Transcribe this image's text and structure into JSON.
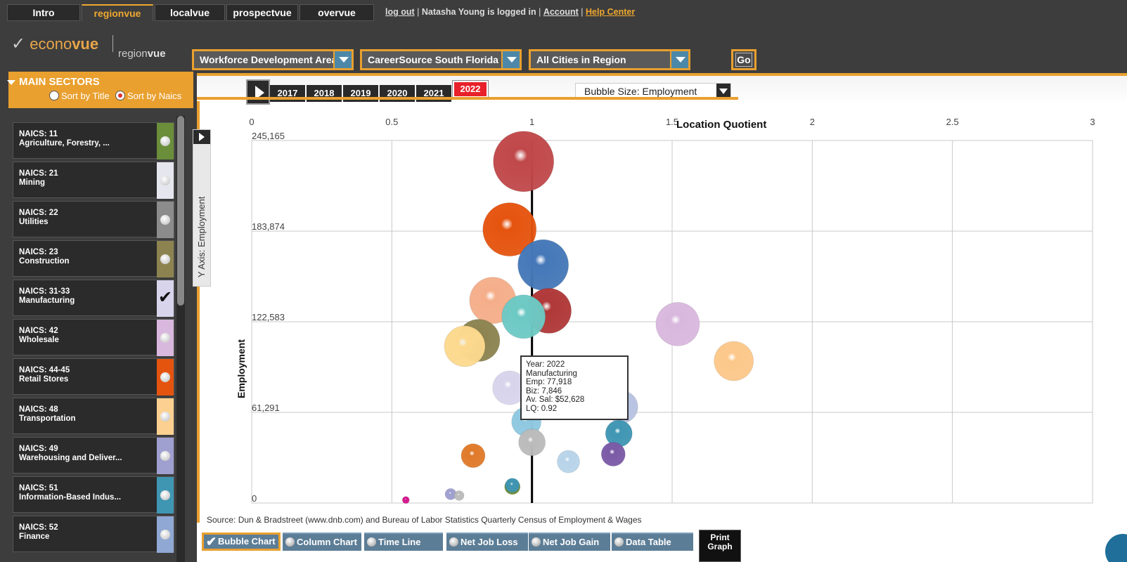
{
  "nav": {
    "tabs": [
      "Intro",
      "regionvue",
      "localvue",
      "prospectvue",
      "overvue"
    ],
    "active_index": 1,
    "log_out": "log out",
    "separator1": " | ",
    "user_text": "Natasha Young is logged in",
    "separator2": " | ",
    "account": "Account",
    "separator3": " | ",
    "help_center": "Help Center"
  },
  "logo": {
    "brand_light": "econo",
    "brand_bold": "vue",
    "sub_light": "region",
    "sub_bold": "vue"
  },
  "filters": {
    "area_type": "Workforce Development Areas",
    "region": "CareerSource South Florida",
    "cities": "All Cities in Region",
    "go_label": "Go"
  },
  "sidebar": {
    "title": "MAIN SECTORS",
    "sort_title": "Sort by Title",
    "sort_naics": "Sort by Naics",
    "sort_selected": "naics",
    "sectors": [
      {
        "code": "NAICS: 11",
        "name": "Agriculture, Forestry, ...",
        "color": "#6b8e3a",
        "checked": false
      },
      {
        "code": "NAICS: 21",
        "name": "Mining",
        "color": "#e6e6ee",
        "checked": false
      },
      {
        "code": "NAICS: 22",
        "name": "Utilities",
        "color": "#8c8c8c",
        "checked": false
      },
      {
        "code": "NAICS: 23",
        "name": "Construction",
        "color": "#8c8350",
        "checked": false
      },
      {
        "code": "NAICS: 31-33",
        "name": "Manufacturing",
        "color": "#d8d4ec",
        "checked": true
      },
      {
        "code": "NAICS: 42",
        "name": "Wholesale",
        "color": "#d9b8de",
        "checked": false
      },
      {
        "code": "NAICS: 44-45",
        "name": "Retail Stores",
        "color": "#e5540f",
        "checked": false
      },
      {
        "code": "NAICS: 48",
        "name": "Transportation",
        "color": "#fcd090",
        "checked": false
      },
      {
        "code": "NAICS: 49",
        "name": "Warehousing and Deliver...",
        "color": "#9f9fd0",
        "checked": false
      },
      {
        "code": "NAICS: 51",
        "name": "Information-Based Indus...",
        "color": "#3f96b3",
        "checked": false
      },
      {
        "code": "NAICS: 52",
        "name": "Finance",
        "color": "#8fa8d4",
        "checked": false
      }
    ]
  },
  "years": [
    "2017",
    "2018",
    "2019",
    "2020",
    "2021",
    "2022"
  ],
  "selected_year": "2022",
  "bubble_size_label": "Bubble Size: Employment",
  "y_axis_tab_label": "Y Axis: Employment",
  "chart_data": {
    "type": "scatter",
    "title": "",
    "xlabel": "Location Quotient",
    "ylabel": "Employment",
    "x_ticks": [
      "0",
      "0.5",
      "1",
      "1.5",
      "2",
      "2.5",
      "3"
    ],
    "y_ticks": [
      "0",
      "61,291",
      "122,583",
      "183,874",
      "245,165"
    ],
    "xlim": [
      0,
      3
    ],
    "ylim": [
      0,
      245165
    ],
    "reference_line_x": 1,
    "grid": true,
    "points": [
      {
        "x": 0.97,
        "y": 231000,
        "size": 43,
        "color": "#c0484a"
      },
      {
        "x": 0.92,
        "y": 185000,
        "size": 38,
        "color": "#e5540f"
      },
      {
        "x": 1.04,
        "y": 161000,
        "size": 36,
        "color": "#4578b8"
      },
      {
        "x": 0.86,
        "y": 137000,
        "size": 33,
        "color": "#f5ae8a"
      },
      {
        "x": 1.06,
        "y": 130000,
        "size": 32,
        "color": "#b03838"
      },
      {
        "x": 0.97,
        "y": 126000,
        "size": 31,
        "color": "#6dc9c4"
      },
      {
        "x": 0.81,
        "y": 110000,
        "size": 30,
        "color": "#8c8350"
      },
      {
        "x": 0.76,
        "y": 106000,
        "size": 29,
        "color": "#fcd98e"
      },
      {
        "x": 1.52,
        "y": 121000,
        "size": 31,
        "color": "#d9b8de"
      },
      {
        "x": 1.72,
        "y": 96000,
        "size": 28,
        "color": "#fcc88a"
      },
      {
        "x": 0.92,
        "y": 77918,
        "size": 24,
        "color": "#d8d4ec"
      },
      {
        "x": 1.32,
        "y": 65000,
        "size": 23,
        "color": "#b6c2e0"
      },
      {
        "x": 0.98,
        "y": 55000,
        "size": 21,
        "color": "#8ec8e0"
      },
      {
        "x": 1.31,
        "y": 47000,
        "size": 19,
        "color": "#3f96b3"
      },
      {
        "x": 1.0,
        "y": 41000,
        "size": 19,
        "color": "#bbbbbb"
      },
      {
        "x": 1.29,
        "y": 33000,
        "size": 17,
        "color": "#7b5aa6"
      },
      {
        "x": 0.79,
        "y": 32000,
        "size": 17,
        "color": "#e07a2a"
      },
      {
        "x": 1.13,
        "y": 28000,
        "size": 16,
        "color": "#b8d4ea"
      },
      {
        "x": 0.93,
        "y": 11000,
        "size": 11,
        "color": "#6b8e3a"
      },
      {
        "x": 0.93,
        "y": 12000,
        "size": 10,
        "color": "#3f96b3"
      },
      {
        "x": 0.71,
        "y": 6000,
        "size": 8,
        "color": "#9f9fd0"
      },
      {
        "x": 0.74,
        "y": 5000,
        "size": 7,
        "color": "#bbbbbb"
      },
      {
        "x": 0.55,
        "y": 2000,
        "size": 5,
        "color": "#d4148c"
      }
    ]
  },
  "tooltip": {
    "year": "Year: 2022",
    "sector": "Manufacturing",
    "emp": "Emp: 77,918",
    "biz": "Biz: 7,846",
    "sal": "Av. Sal: $52,628",
    "lq": "LQ: 0.92"
  },
  "source": "Source: Dun & Bradstreet (www.dnb.com) and Bureau of Labor Statistics Quarterly Census of Employment & Wages",
  "view_tabs": [
    "Bubble Chart",
    "Column Chart",
    "Time Line",
    "Net Job Loss",
    "Net Job Gain",
    "Data Table"
  ],
  "active_view": "Bubble Chart",
  "print_graph": "Print Graph"
}
